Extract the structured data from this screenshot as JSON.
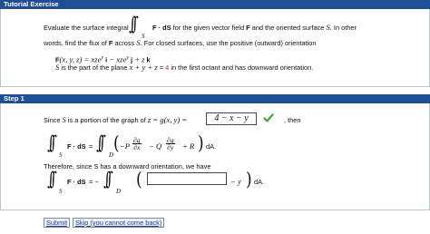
{
  "tutorial": {
    "header": "Tutorial Exercise",
    "line1_before": "Evaluate the surface integral",
    "line1_integrand": "F · dS",
    "line1_after": "for the given vector field",
    "line1_F": "F",
    "line1_and": "and the oriented surface",
    "line1_S": "S",
    "line1_tail": ". In other",
    "line2_before": "words, find the flux of",
    "line2_F": "F",
    "line2_after": "across",
    "line2_S": "S",
    "line2_tail": ". For closed surfaces, use the positive (outward) orientation",
    "field_F": "F",
    "field_expr": "(x, y, z) = xze",
    "field_exp1": "y",
    "field_i": " i",
    "field_mid": " − xze",
    "field_exp2": "y",
    "field_j": " j",
    "field_plus": " + z",
    "field_k": " k",
    "surface_S": "S",
    "surface_text": " is the part of the plane ",
    "surface_eq": "x + y + z",
    "surface_eq_sign": " = ",
    "surface_value": "4",
    "surface_tail": " in the first octant and has downward orientation.",
    "integral_sub": "S"
  },
  "step": {
    "header": "Step 1",
    "since_before": "Since ",
    "since_S": "S",
    "since_mid": " is a portion of the graph of ",
    "since_eq": "z = g(x, y) =",
    "answer_value": "4 − x − y",
    "then_text": ", then",
    "eq1_lhs": "F · dS",
    "eq1_equals": "=",
    "eq1_inner_a": "−P",
    "eq1_frac1_num": "∂g",
    "eq1_frac1_den": "∂x",
    "eq1_minus": "− Q",
    "eq1_frac2_num": "∂g",
    "eq1_frac2_den": "∂y",
    "eq1_plus_R": "+ R",
    "eq1_dA": "dA.",
    "sub_S": "S",
    "sub_D": "D",
    "therefore_text": "Therefore, since S has a downward orientation, we have",
    "eq2_lhs": "F · dS",
    "eq2_equals": "= −",
    "eq2_tail": "− y",
    "eq2_dA": "dA.",
    "answer2_value": ""
  },
  "buttons": {
    "submit": "Submit",
    "skip": "Skip (you cannot come back)"
  },
  "colors": {
    "header_bg": "#1f4e94",
    "highlight_red": "#d2232a",
    "check_green": "#3aa43a"
  },
  "icons": {
    "check": "check-icon"
  }
}
